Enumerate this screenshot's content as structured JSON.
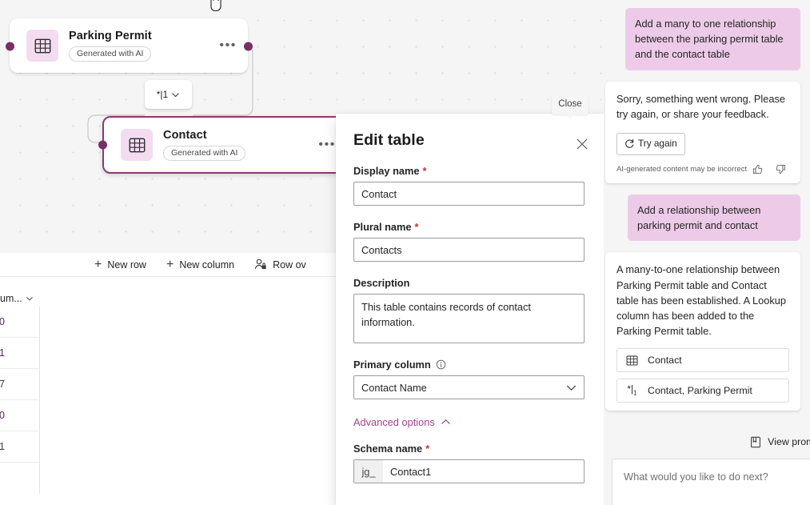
{
  "canvas": {
    "tables": [
      {
        "name": "Parking Permit",
        "chip": "Generated with AI",
        "icon": "table-icon",
        "menu": "•••",
        "selected": false
      },
      {
        "name": "Contact",
        "chip": "Generated with AI",
        "icon": "table-icon",
        "menu": "•••",
        "selected": true
      }
    ],
    "relationship_badge": {
      "label": "*|1",
      "chevron": "chevron-down-icon"
    },
    "cursor": "grab-hand-cursor"
  },
  "grid": {
    "toolbar": [
      {
        "label": "New row",
        "icon": "plus-icon"
      },
      {
        "label": "New column",
        "icon": "plus-icon"
      },
      {
        "label": "Row ov",
        "icon": "row-ownership-icon"
      }
    ],
    "column_header": "um...",
    "cells": [
      "0",
      "1",
      "7",
      "0",
      "1"
    ]
  },
  "dialog": {
    "title": "Edit table",
    "close_icon": "close-icon",
    "close_tooltip": "Close",
    "display_name": {
      "label": "Display name",
      "required": "*",
      "value": "Contact"
    },
    "plural_name": {
      "label": "Plural name",
      "required": "*",
      "value": "Contacts"
    },
    "description": {
      "label": "Description",
      "value": "This table contains records of contact information."
    },
    "primary_column": {
      "label": "Primary column",
      "info_icon": "info-icon",
      "value": "Contact Name",
      "chevron": "chevron-down-icon"
    },
    "advanced_options": {
      "label": "Advanced options",
      "chevron": "chevron-up-icon"
    },
    "schema_name": {
      "label": "Schema name",
      "required": "*",
      "prefix": "jg_",
      "value": "Contact1"
    }
  },
  "chat": {
    "messages": [
      {
        "role": "user",
        "text": "Add a many to one relationship between the parking permit table and the contact table"
      },
      {
        "role": "assistant",
        "text": "Sorry, something went wrong. Please try again, or share your feedback.",
        "action": {
          "label": "Try again",
          "icon": "refresh-icon"
        },
        "disclaimer": "AI-generated content may be incorrect",
        "feedback": {
          "up": "thumbs-up-icon",
          "down": "thumbs-down-icon"
        }
      },
      {
        "role": "user",
        "text": "Add a relationship between parking permit and contact"
      },
      {
        "role": "assistant",
        "text": "A many-to-one relationship between Parking Permit table and Contact table has been established. A Lookup column has been added to the Parking Permit table.",
        "entities": [
          {
            "label": "Contact",
            "icon": "table-icon"
          },
          {
            "label": "Contact, Parking Permit",
            "icon": "relationship-icon"
          }
        ]
      }
    ],
    "view_prompts": {
      "label": "View prompts",
      "icon": "book-icon"
    },
    "composer_placeholder": "What would you like to do next?"
  },
  "colors": {
    "accent": "#a4428e",
    "selection": "#8a3a75",
    "port": "#7a2d66",
    "user_bubble": "#edcbe8",
    "icon_tile": "#f3dcf0",
    "canvas": "#f5f5f5",
    "required": "#c0392f"
  }
}
